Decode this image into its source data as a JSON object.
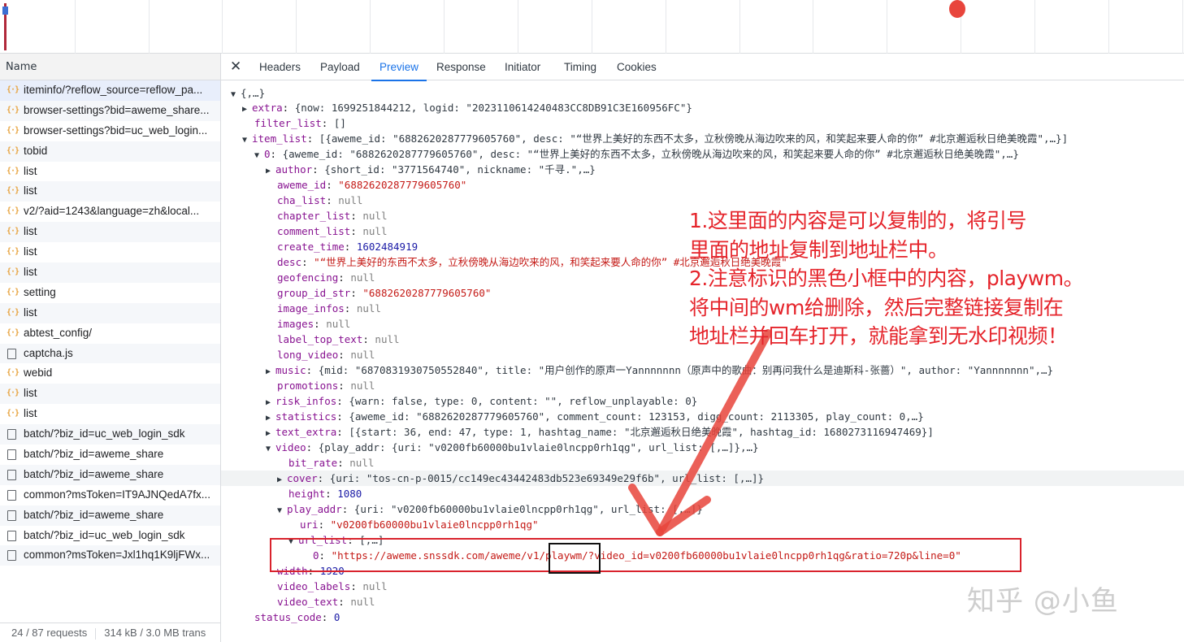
{
  "colors": {
    "accent": "#1a73e8",
    "annotation_red": "#e5242b",
    "string": "#c41a16",
    "key": "#881391",
    "number": "#1a1aa6"
  },
  "left": {
    "header": "Name",
    "requests": [
      {
        "name": "iteminfo/?reflow_source=reflow_pa...",
        "icon": "braces-icon"
      },
      {
        "name": "browser-settings?bid=aweme_share...",
        "icon": "braces-icon"
      },
      {
        "name": "browser-settings?bid=uc_web_login...",
        "icon": "braces-icon"
      },
      {
        "name": "tobid",
        "icon": "braces-icon"
      },
      {
        "name": "list",
        "icon": "braces-icon"
      },
      {
        "name": "list",
        "icon": "braces-icon"
      },
      {
        "name": "v2/?aid=1243&language=zh&local...",
        "icon": "braces-icon"
      },
      {
        "name": "list",
        "icon": "braces-icon"
      },
      {
        "name": "list",
        "icon": "braces-icon"
      },
      {
        "name": "list",
        "icon": "braces-icon"
      },
      {
        "name": "setting",
        "icon": "braces-icon"
      },
      {
        "name": "list",
        "icon": "braces-icon"
      },
      {
        "name": "abtest_config/",
        "icon": "braces-icon"
      },
      {
        "name": "captcha.js",
        "icon": "document-icon"
      },
      {
        "name": "webid",
        "icon": "braces-icon"
      },
      {
        "name": "list",
        "icon": "braces-icon"
      },
      {
        "name": "list",
        "icon": "braces-icon"
      },
      {
        "name": "batch/?biz_id=uc_web_login_sdk",
        "icon": "document-icon"
      },
      {
        "name": "batch/?biz_id=aweme_share",
        "icon": "document-icon"
      },
      {
        "name": "batch/?biz_id=aweme_share",
        "icon": "document-icon"
      },
      {
        "name": "common?msToken=IT9AJNQedA7fx...",
        "icon": "document-icon"
      },
      {
        "name": "batch/?biz_id=aweme_share",
        "icon": "document-icon"
      },
      {
        "name": "batch/?biz_id=uc_web_login_sdk",
        "icon": "document-icon"
      },
      {
        "name": "common?msToken=Jxl1hq1K9ljFWx...",
        "icon": "document-icon"
      }
    ],
    "footer_requests": "24 / 87 requests",
    "footer_transfer": "314 kB / 3.0 MB trans"
  },
  "tabs": [
    "Headers",
    "Payload",
    "Preview",
    "Response",
    "Initiator",
    "Timing",
    "Cookies"
  ],
  "active_tab": "Preview",
  "preview": {
    "root": "{,…}",
    "extra_key": "extra",
    "extra_val": "{now: 1699251844212, logid: \"2023110614240483CC8DB91C3E160956FC\"}",
    "filter_key": "filter_list",
    "filter_val": "[]",
    "item_list_key": "item_list",
    "item_list_val": "[{aweme_id: \"6882620287779605760\", desc: \"“世界上美好的东西不太多，立秋傍晚从海边吹来的风，和笑起来要人命的你” #北京邂逅秋日绝美晚霞\",…}]",
    "item0_key": "0",
    "item0_val": "{aweme_id: \"6882620287779605760\", desc: \"“世界上美好的东西不太多，立秋傍晚从海边吹来的风，和笑起来要人命的你” #北京邂逅秋日绝美晚霞\",…}",
    "author_key": "author",
    "author_val": "{short_id: \"3771564740\", nickname: \"千寻.\",…}",
    "aweme_id_key": "aweme_id",
    "aweme_id_val": "\"6882620287779605760\"",
    "cha_list_key": "cha_list",
    "chapter_list_key": "chapter_list",
    "comment_list_key": "comment_list",
    "create_time_key": "create_time",
    "create_time_val": "1602484919",
    "desc_key": "desc",
    "desc_val": "\"“世界上美好的东西不太多，立秋傍晚从海边吹来的风，和笑起来要人命的你” #北京邂逅秋日绝美晚霞\"",
    "geofencing_key": "geofencing",
    "group_id_str_key": "group_id_str",
    "group_id_str_val": "\"6882620287779605760\"",
    "image_infos_key": "image_infos",
    "images_key": "images",
    "label_top_text_key": "label_top_text",
    "long_video_key": "long_video",
    "music_key": "music",
    "music_val": "{mid: \"6870831930750552840\", title: \"用户创作的原声一Yannnnnnn（原声中的歌曲：别再问我什么是迪斯科-张蔷）\", author: \"Yannnnnnn\",…}",
    "promotions_key": "promotions",
    "risk_infos_key": "risk_infos",
    "risk_infos_val": "{warn: false, type: 0, content: \"\", reflow_unplayable: 0}",
    "statistics_key": "statistics",
    "statistics_val": "{aweme_id: \"6882620287779605760\", comment_count: 123153, digg_count: 2113305, play_count: 0,…}",
    "text_extra_key": "text_extra",
    "text_extra_val": "[{start: 36, end: 47, type: 1, hashtag_name: \"北京邂逅秋日绝美晚霞\", hashtag_id: 1680273116947469}]",
    "video_key": "video",
    "video_val": "{play_addr: {uri: \"v0200fb60000bu1vlaie0lncpp0rh1qg\", url_list: [,…]},…}",
    "bit_rate_key": "bit_rate",
    "cover_key": "cover",
    "cover_val": "{uri: \"tos-cn-p-0015/cc149ec43442483db523e69349e29f6b\", url_list: [,…]}",
    "height_key": "height",
    "height_val": "1080",
    "play_addr_key": "play_addr",
    "play_addr_val": "{uri: \"v0200fb60000bu1vlaie0lncpp0rh1qg\", url_list: [,…]}",
    "uri_key": "uri",
    "uri_val": "\"v0200fb60000bu1vlaie0lncpp0rh1qg\"",
    "url_list_key": "url_list",
    "url_list_val": "[,…]",
    "url0_key": "0",
    "url0_val_a": "\"https://aweme.snssdk.com/aweme/v1/",
    "url0_val_b": "playwm",
    "url0_val_c": "/?video_id=v0200fb60000bu1vlaie0lncpp0rh1qg&ratio=720p&line=0\"",
    "width_key": "width",
    "width_val": "1920",
    "video_labels_key": "video_labels",
    "video_text_key": "video_text",
    "status_code_key": "status_code",
    "status_code_val": "0",
    "null": "null"
  },
  "annotation": {
    "lines": [
      "1.这里面的内容是可以复制的，将引号",
      "里面的地址复制到地址栏中。",
      "2.注意标识的黑色小框中的内容，playwm。",
      "将中间的wm给删除，然后完整链接复制在",
      "地址栏并回车打开，就能拿到无水印视频！"
    ]
  },
  "watermark": "知乎 @小鱼"
}
